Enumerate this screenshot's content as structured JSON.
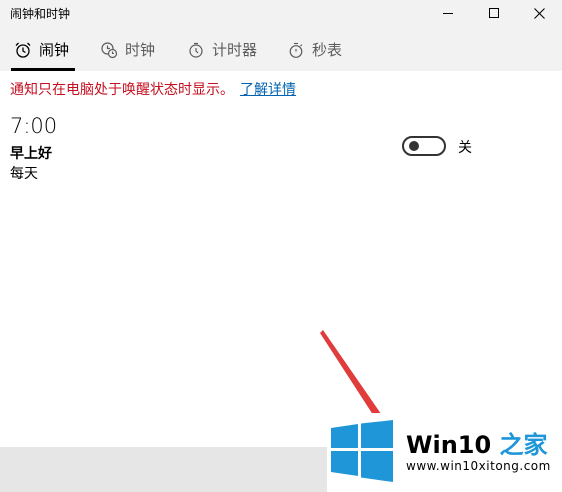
{
  "window": {
    "title": "闹钟和时钟",
    "controls": [
      "minimize-icon",
      "maximize-icon",
      "close-icon"
    ]
  },
  "tabs": [
    {
      "label": "闹钟",
      "icon": "alarm-clock-icon",
      "active": true
    },
    {
      "label": "时钟",
      "icon": "world-clock-icon",
      "active": false
    },
    {
      "label": "计时器",
      "icon": "timer-icon",
      "active": false
    },
    {
      "label": "秒表",
      "icon": "stopwatch-icon",
      "active": false
    }
  ],
  "notice": {
    "text": "通知只在电脑处于唤醒状态时显示。",
    "link_label": "了解详情"
  },
  "alarms": [
    {
      "time": "7:00",
      "name": "早上好",
      "repeat": "每天",
      "enabled": false,
      "toggle_label": "关"
    }
  ],
  "watermark": {
    "brand": "Win10",
    "brand_suffix": "之家",
    "url": "www.win10xitong.com"
  },
  "colors": {
    "chrome_bg": "#f2f2f2",
    "notice_red": "#c50f1f",
    "link_blue": "#0063b1",
    "annotation_red": "#e03c3c",
    "windows_logo_blue": "#1e96d8",
    "bottom_bar": "#e6e6e6"
  }
}
